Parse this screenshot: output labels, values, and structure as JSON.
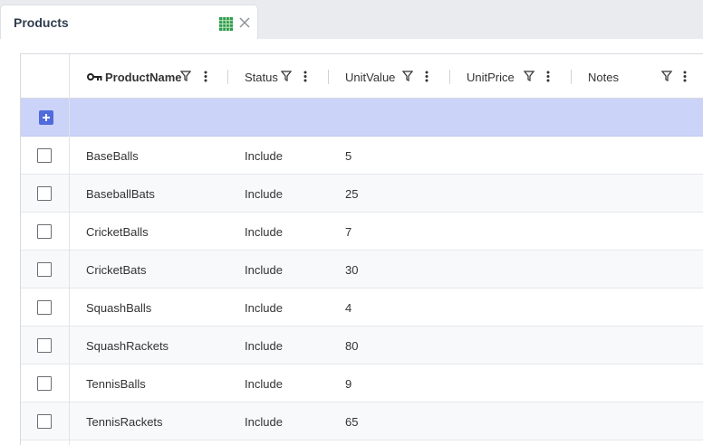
{
  "tab": {
    "title": "Products",
    "icons": {
      "grid": "spreadsheet-icon",
      "close": "close-icon"
    }
  },
  "grid": {
    "columns": [
      {
        "label": "ProductName",
        "primary_key": true,
        "icon": "key-icon"
      },
      {
        "label": "Status"
      },
      {
        "label": "UnitValue"
      },
      {
        "label": "UnitPrice"
      },
      {
        "label": "Notes"
      }
    ],
    "add_row_icon": "add-icon",
    "rows": [
      {
        "product": "BaseBalls",
        "status": "Include",
        "unit_value": "5",
        "unit_price": "",
        "notes": ""
      },
      {
        "product": "BaseballBats",
        "status": "Include",
        "unit_value": "25",
        "unit_price": "",
        "notes": ""
      },
      {
        "product": "CricketBalls",
        "status": "Include",
        "unit_value": "7",
        "unit_price": "",
        "notes": ""
      },
      {
        "product": "CricketBats",
        "status": "Include",
        "unit_value": "30",
        "unit_price": "",
        "notes": ""
      },
      {
        "product": "SquashBalls",
        "status": "Include",
        "unit_value": "4",
        "unit_price": "",
        "notes": ""
      },
      {
        "product": "SquashRackets",
        "status": "Include",
        "unit_value": "80",
        "unit_price": "",
        "notes": ""
      },
      {
        "product": "TennisBalls",
        "status": "Include",
        "unit_value": "9",
        "unit_price": "",
        "notes": ""
      },
      {
        "product": "TennisRackets",
        "status": "Include",
        "unit_value": "65",
        "unit_price": "",
        "notes": ""
      }
    ]
  },
  "colors": {
    "add_row_bg": "#ccd3f8",
    "add_button": "#4f6bdc",
    "tab_icon_green": "#2e9b47",
    "page_bg": "#e9ebef"
  }
}
